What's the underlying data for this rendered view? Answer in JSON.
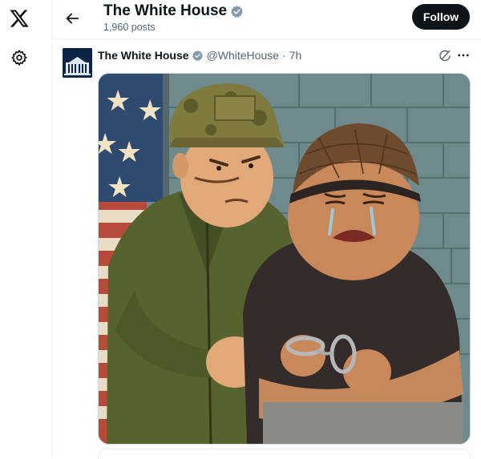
{
  "header": {
    "title": "The White House",
    "post_count": "1,960 posts",
    "follow_label": "Follow"
  },
  "post": {
    "author_name": "The White House",
    "handle": "@WhiteHouse",
    "separator": "·",
    "time": "7h"
  },
  "icons": {
    "logo": "x-logo-icon",
    "settings": "gear-icon",
    "back": "back-arrow-icon",
    "verified": "verified-badge-icon",
    "grok": "grok-icon",
    "more": "more-icon"
  },
  "colors": {
    "follow_bg": "#0f1419",
    "verified": "#829aab",
    "secondary_text": "#536471"
  }
}
